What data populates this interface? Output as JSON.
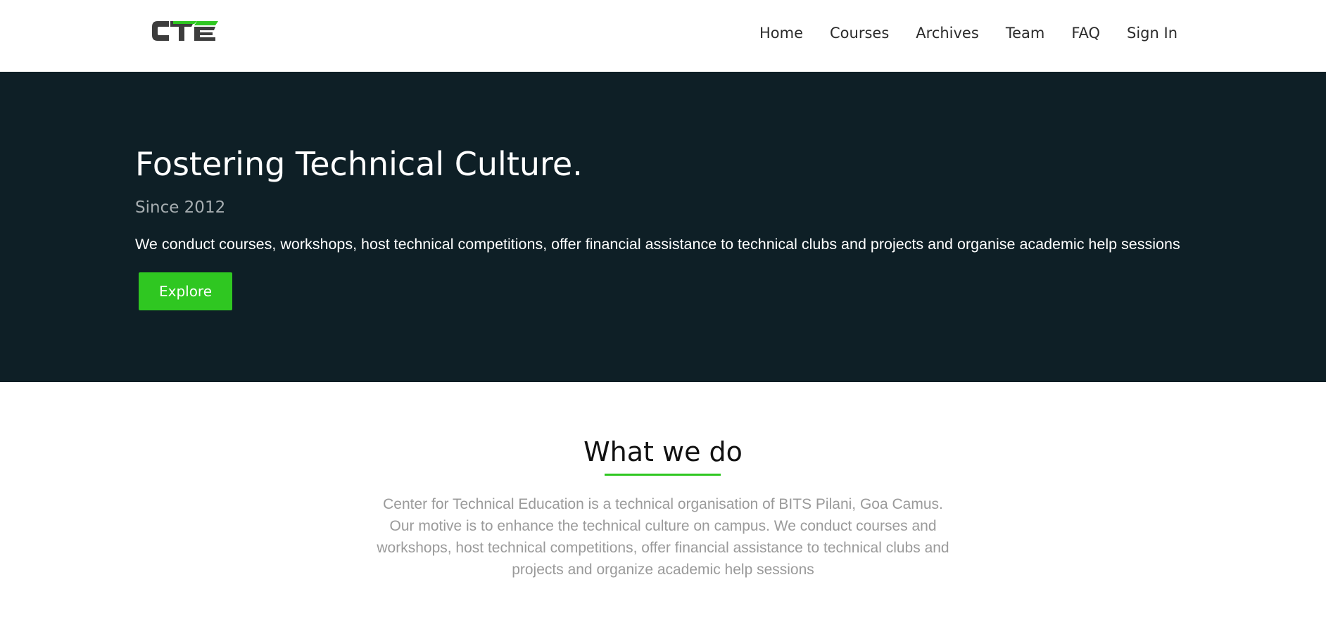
{
  "brand": {
    "logo_text": "CTE",
    "logo_dark_color": "#3d3d3d",
    "logo_accent_color": "#2fc721"
  },
  "nav": {
    "items": [
      {
        "label": "Home"
      },
      {
        "label": "Courses"
      },
      {
        "label": "Archives"
      },
      {
        "label": "Team"
      },
      {
        "label": "FAQ"
      },
      {
        "label": "Sign In"
      }
    ]
  },
  "hero": {
    "title": "Fostering Technical Culture.",
    "subtitle": "Since 2012",
    "description": "We conduct courses, workshops, host technical competitions, offer financial assistance to technical clubs and projects and organise academic help sessions",
    "cta_label": "Explore",
    "background_color": "#0e1f26",
    "accent_color": "#2fc721"
  },
  "what_we_do": {
    "title": "What we do",
    "body": "Center for Technical Education is a technical organisation of BITS Pilani, Goa Camus. Our motive is to enhance the technical culture on campus. We conduct courses and workshops, host technical competitions, offer financial assistance to technical clubs and projects and organize academic help sessions"
  }
}
